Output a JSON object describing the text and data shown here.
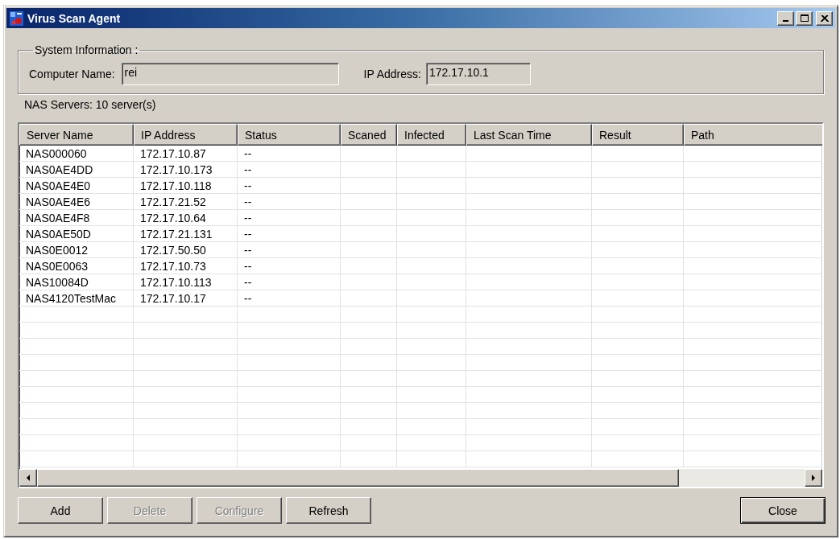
{
  "window": {
    "title": "Virus Scan Agent"
  },
  "system_information": {
    "title": "System Information :",
    "fields": [
      {
        "label": "Computer Name:",
        "value": "rei"
      },
      {
        "label": "IP Address:",
        "value": "172.17.10.1"
      }
    ]
  },
  "servers_label": "NAS Servers: 10 server(s)",
  "table": {
    "columns": [
      "Server Name",
      "IP Address",
      "Status",
      "Scaned",
      "Infected",
      "Last Scan Time",
      "Result",
      "Path"
    ],
    "rows": [
      {
        "cells": [
          "NAS000060",
          "172.17.10.87",
          "--"
        ]
      },
      {
        "cells": [
          "NAS0AE4DD",
          "172.17.10.173",
          "--"
        ]
      },
      {
        "cells": [
          "NAS0AE4E0",
          "172.17.10.118",
          "--"
        ]
      },
      {
        "cells": [
          "NAS0AE4E6",
          "172.17.21.52",
          "--"
        ]
      },
      {
        "cells": [
          "NAS0AE4F8",
          "172.17.10.64",
          "--"
        ]
      },
      {
        "cells": [
          "NAS0AE50D",
          "172.17.21.131",
          "--"
        ]
      },
      {
        "cells": [
          "NAS0E0012",
          "172.17.50.50",
          "--"
        ]
      },
      {
        "cells": [
          "NAS0E0063",
          "172.17.10.73",
          "--"
        ]
      },
      {
        "cells": [
          "NAS10084D",
          "172.17.10.113",
          "--"
        ]
      },
      {
        "cells": [
          "NAS4120TestMac",
          "172.17.10.17",
          "--"
        ]
      }
    ]
  },
  "buttons": [
    {
      "label": "Add",
      "disabled": false,
      "default": false
    },
    {
      "label": "Delete",
      "disabled": true,
      "default": false
    },
    {
      "label": "Configure",
      "disabled": true,
      "default": false
    },
    {
      "label": "Refresh",
      "disabled": false,
      "default": false
    }
  ],
  "close_button": {
    "label": "Close",
    "disabled": false,
    "default": true
  }
}
